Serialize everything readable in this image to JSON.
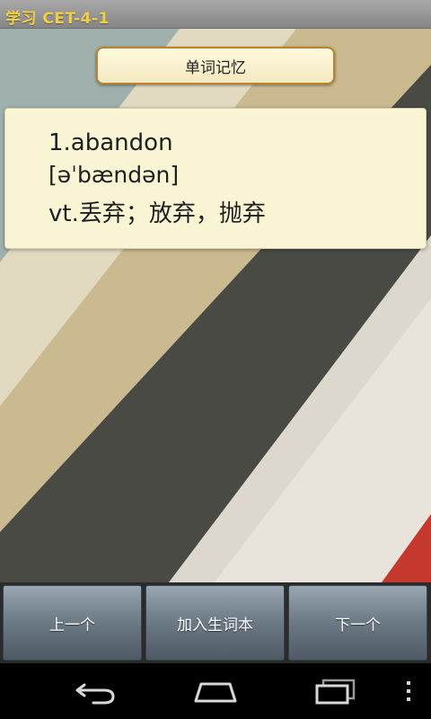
{
  "app": {
    "title": "学习 CET-4-1"
  },
  "header": {
    "label": "单词记忆"
  },
  "word_card": {
    "word": "1.abandon",
    "phonetic": "[əˈbændən]",
    "definition": "vt.丢弃；放弃，抛弃"
  },
  "buttons": {
    "prev": "上一个",
    "add_to_vocab": "加入生词本",
    "next": "下一个"
  },
  "colors": {
    "title_text": "#f0cf45",
    "card_bg": "#f8f4d4",
    "header_border": "#b9832f",
    "button_gradient_top": "#9aa7b2",
    "button_gradient_bottom": "#4e5a66"
  },
  "navigation": {
    "icons": [
      "back-icon",
      "home-icon",
      "recent-apps-icon",
      "menu-icon"
    ]
  }
}
